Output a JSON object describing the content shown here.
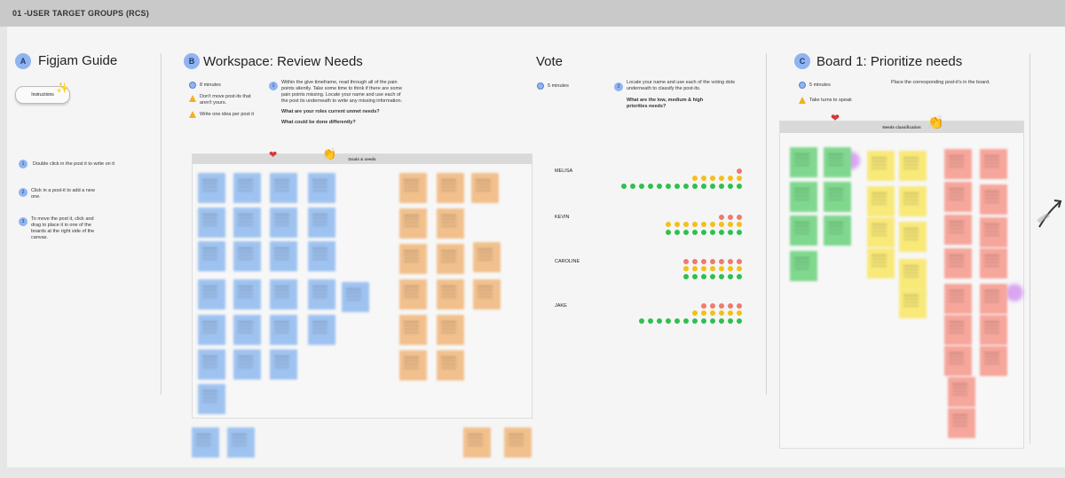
{
  "frame": {
    "title": "01 -USER TARGET GROUPS (RCS)"
  },
  "guide": {
    "badge": "A",
    "title": "Figjam Guide",
    "button": "Instructions",
    "steps": [
      {
        "num": "1",
        "text": "Double click in the post it to write on it"
      },
      {
        "num": "2",
        "text": "Click in a post-it to add a new one."
      },
      {
        "num": "3",
        "text": "To move the post it, click and drag to place it in one of the boards at the right side of the canvas."
      }
    ]
  },
  "workspace": {
    "badge": "B",
    "title": "Workspace: Review Needs",
    "time": "8 minutes",
    "rule1": "Don't move post-its that aren't yours.",
    "rule2": "Write one idea per post it",
    "step_num": "1",
    "instructions": "Within the give timeframe, read through all of the pain points silently. Take some time to think if there are some pain points missing. Locate your name and use each of the post its underneath to write any missing information.",
    "q1": "What are your roles current unmet needs?",
    "q2": "What could be done differently?",
    "board_title": "Goals & needs"
  },
  "vote": {
    "title": "Vote",
    "time": "5 minutes",
    "step_num": "2",
    "instructions": "Locate your name and use each of the voting dots underneath to classify the post-its.",
    "question": "What are the low, medium & high priorities needs?",
    "people": [
      {
        "name": "MELISA",
        "red": 1,
        "yellow": 6,
        "green": 14
      },
      {
        "name": "KEVIN",
        "red": 3,
        "yellow": 9,
        "green": 9
      },
      {
        "name": "CAROLINE",
        "red": 7,
        "yellow": 7,
        "green": 7
      },
      {
        "name": "JAKE",
        "red": 5,
        "yellow": 6,
        "green": 12
      }
    ]
  },
  "board1": {
    "badge": "C",
    "title": "Board  1: Prioritize needs",
    "time": "5 minutes",
    "rule": "Take turns to speak",
    "instructions": "Place the corresponding post-it's in the board.",
    "board_title": "Needs classification"
  },
  "colors": {
    "green": "#2fbf4f",
    "yellow": "#f2c01a",
    "red": "#ee7a72",
    "accent": "#8fb4f0"
  }
}
